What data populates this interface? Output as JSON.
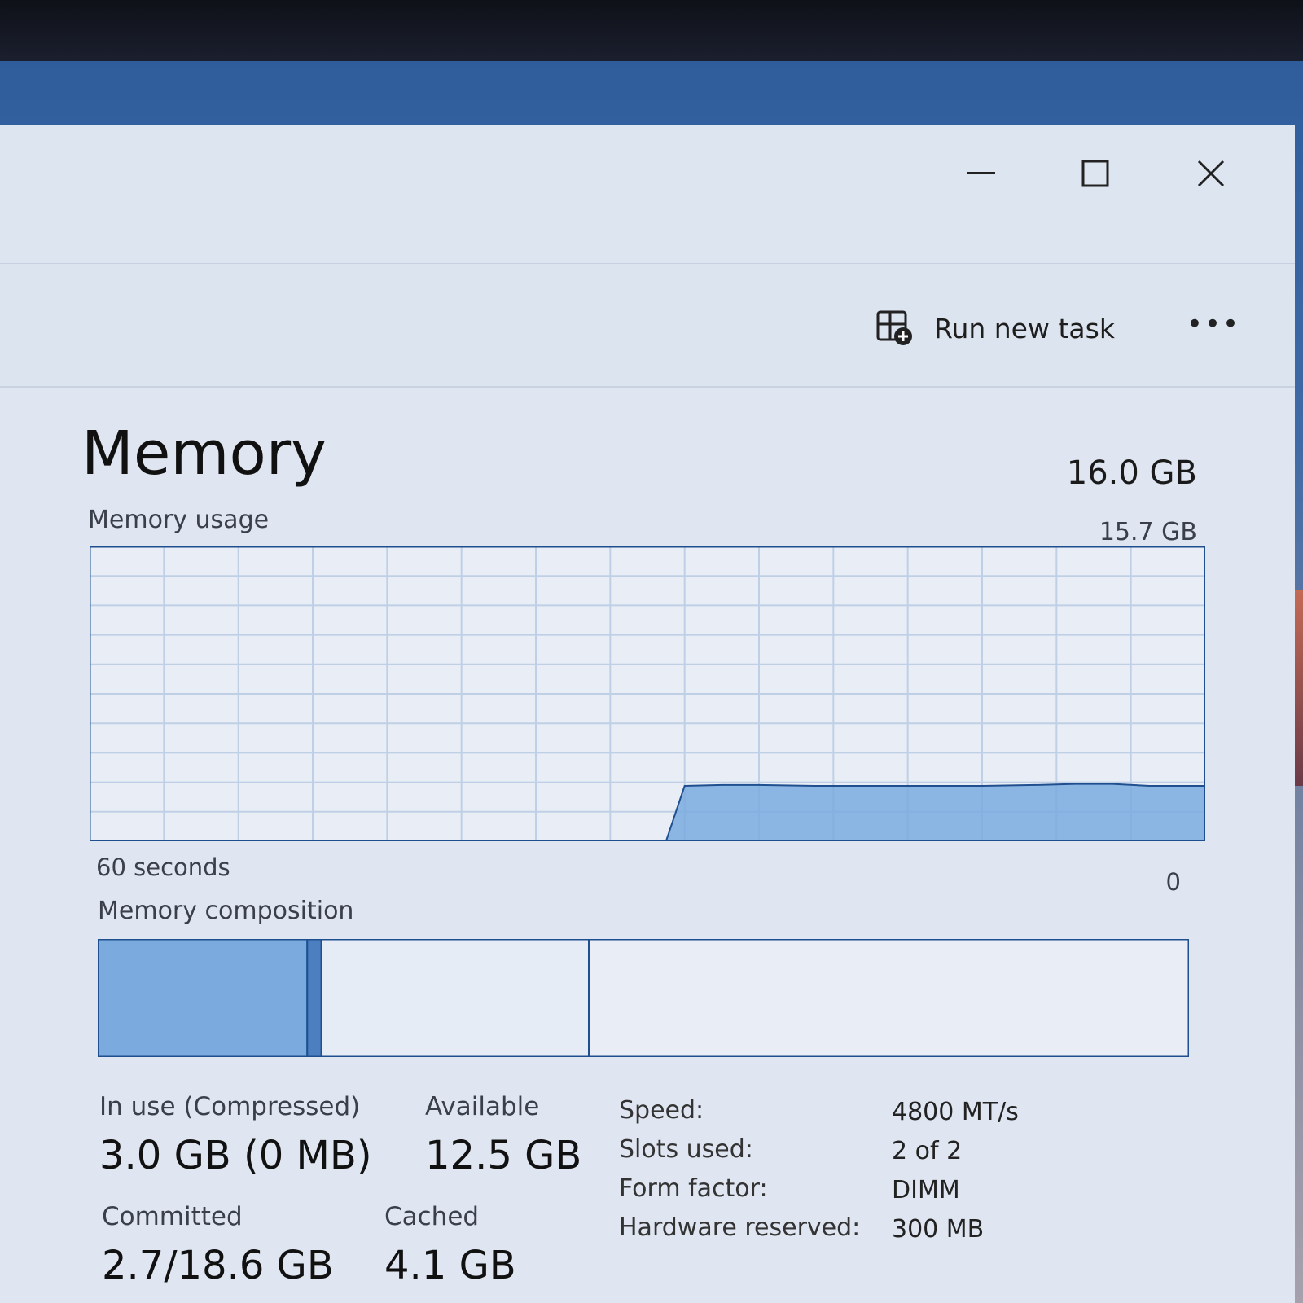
{
  "window": {
    "minimize_glyph": "—",
    "maximize_glyph": "☐",
    "close_glyph": "✕"
  },
  "toolbar": {
    "run_new_task_label": "Run new task",
    "run_new_task_icon": "run-task-icon",
    "more_label": "•••"
  },
  "memory": {
    "title": "Memory",
    "total": "16.0 GB",
    "usage_label": "Memory usage",
    "usage_max": "15.7 GB",
    "axis_left": "60 seconds",
    "axis_right": "0",
    "composition_label": "Memory composition",
    "accent_color": "#7aaade",
    "border_color": "#1f4f8f"
  },
  "chart_data": {
    "type": "area",
    "x": [
      60,
      57,
      54,
      51,
      48,
      45,
      42,
      39,
      36,
      33,
      30,
      29,
      28,
      26,
      24,
      21,
      18,
      15,
      12,
      9,
      7,
      5,
      3,
      1,
      0
    ],
    "values": [
      0,
      0,
      0,
      0,
      0,
      0,
      0,
      0,
      0,
      0,
      0,
      0,
      2.95,
      3.0,
      3.0,
      2.95,
      2.95,
      2.95,
      2.95,
      3.0,
      3.05,
      3.05,
      2.95,
      2.95,
      2.95
    ],
    "xlim": [
      60,
      0
    ],
    "ylim": [
      0,
      15.7
    ],
    "grid": true,
    "xlabel": "60 seconds",
    "ylabel": "Memory usage"
  },
  "composition": {
    "in_use_fraction": 0.192,
    "modified_fraction": 0.013,
    "standby_fraction": 0.245,
    "free_fraction": 0.55
  },
  "stats": {
    "in_use_label": "In use (Compressed)",
    "in_use_value": "3.0 GB (0 MB)",
    "available_label": "Available",
    "available_value": "12.5 GB",
    "committed_label": "Committed",
    "committed_value": "2.7/18.6 GB",
    "cached_label": "Cached",
    "cached_value": "4.1 GB"
  },
  "specs": {
    "speed_label": "Speed:",
    "speed_value": "4800 MT/s",
    "slots_label": "Slots used:",
    "slots_value": "2 of 2",
    "form_label": "Form factor:",
    "form_value": "DIMM",
    "reserved_label": "Hardware reserved:",
    "reserved_value": "300 MB"
  }
}
